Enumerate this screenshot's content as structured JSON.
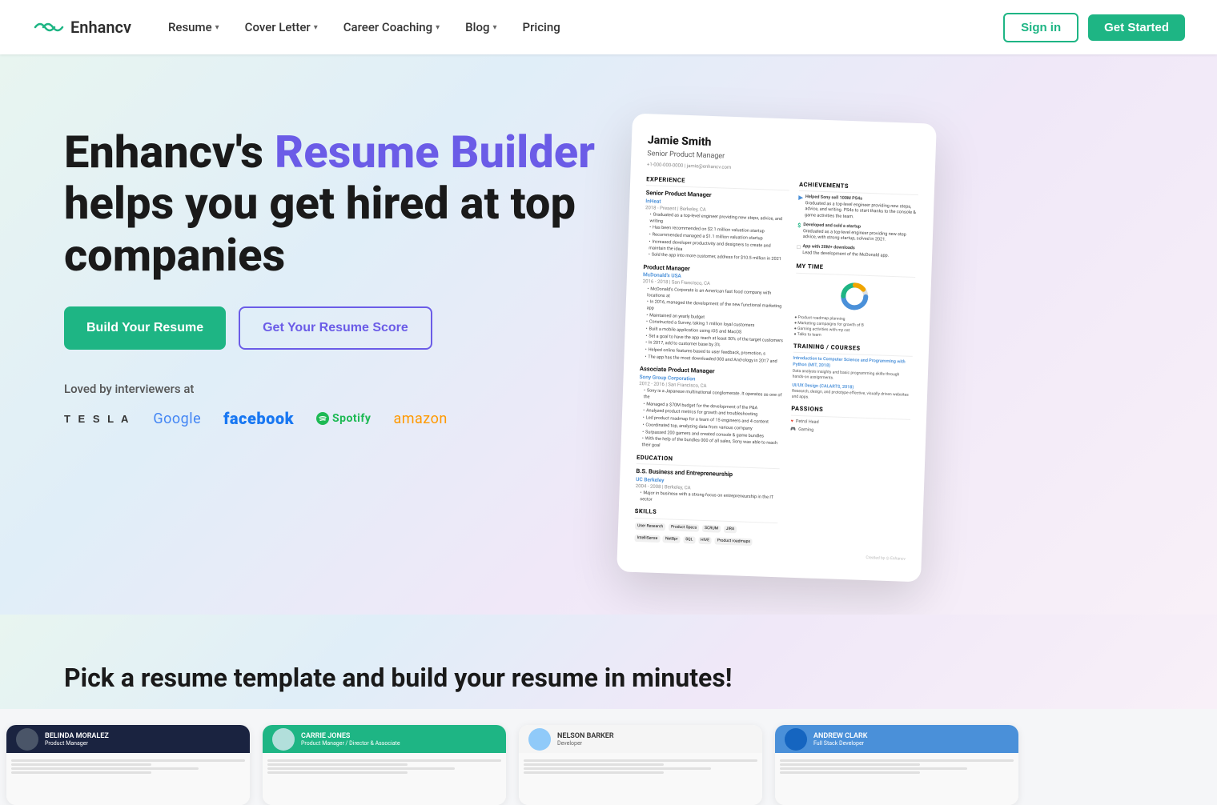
{
  "brand": {
    "name": "Enhancv",
    "logo_alt": "Enhancv logo"
  },
  "nav": {
    "items": [
      {
        "label": "Resume",
        "has_dropdown": true
      },
      {
        "label": "Cover Letter",
        "has_dropdown": true
      },
      {
        "label": "Career Coaching",
        "has_dropdown": true
      },
      {
        "label": "Blog",
        "has_dropdown": true
      },
      {
        "label": "Pricing",
        "has_dropdown": false
      }
    ],
    "signin_label": "Sign in",
    "getstarted_label": "Get Started"
  },
  "hero": {
    "title_plain": "Enhancv's ",
    "title_accent": "Resume Builder",
    "title_rest": " helps you get hired at top companies",
    "btn_build": "Build Your Resume",
    "btn_score": "Get Your Resume Score",
    "loved_text": "Loved by interviewers at",
    "companies": [
      "TESLA",
      "Google",
      "facebook",
      "Spotify",
      "amazon"
    ]
  },
  "bottom_section": {
    "text": "Pick a resume template and build your resume in minutes!"
  },
  "resume_preview": {
    "name": "Jamie Smith",
    "title": "Senior Product Manager",
    "contact": "+1-000-000-0000  |  jamie@enhancv.com",
    "sections": {
      "experience": "EXPERIENCE",
      "achievements": "ACHIEVEMENTS",
      "my_time": "MY TIME",
      "training": "TRAINING / COURSES",
      "education": "EDUCATION",
      "skills": "SKILLS",
      "passions": "PASSIONS"
    }
  },
  "templates": [
    {
      "id": "belinda",
      "name": "BELINDA MORALEZ",
      "role": "Product Manager",
      "color": "dark"
    },
    {
      "id": "carrie",
      "name": "CARRIE JONES",
      "role": "Product Manager / Director & Associate",
      "color": "green"
    },
    {
      "id": "nelson",
      "name": "NELSON BARKER",
      "role": "Developer",
      "color": "light"
    },
    {
      "id": "andrew",
      "name": "ANDREW CLARK",
      "role": "Full Stack Developer",
      "color": "blue"
    }
  ]
}
